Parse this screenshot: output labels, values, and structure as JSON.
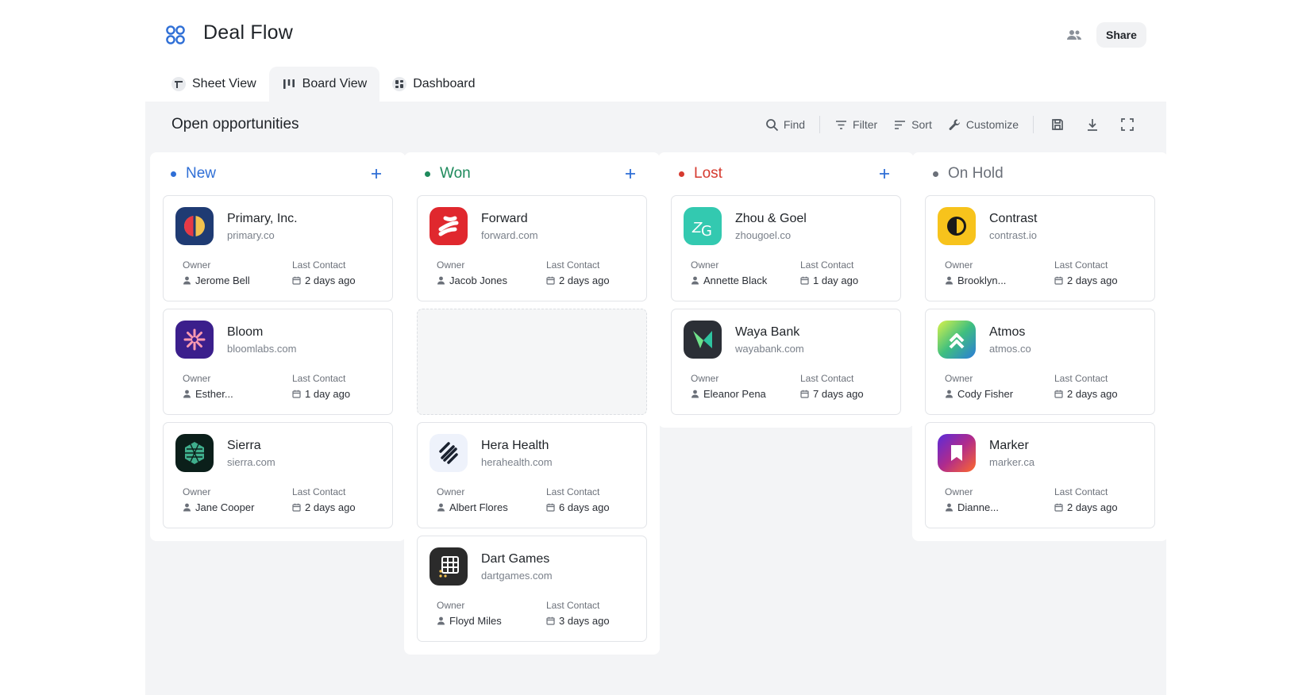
{
  "app": {
    "title": "Deal Flow",
    "share_label": "Share"
  },
  "tabs": [
    {
      "label": "Sheet View",
      "icon": "sheet-icon",
      "active": false
    },
    {
      "label": "Board View",
      "icon": "board-icon",
      "active": true
    },
    {
      "label": "Dashboard",
      "icon": "dashboard-icon",
      "active": false
    }
  ],
  "board": {
    "title": "Open opportunities",
    "toolbar": {
      "find": "Find",
      "filter": "Filter",
      "sort": "Sort",
      "customize": "Customize"
    },
    "field_labels": {
      "owner": "Owner",
      "last_contact": "Last Contact"
    }
  },
  "columns": [
    {
      "title": "New",
      "color": "#2f6fd6",
      "cards": [
        {
          "name": "Primary, Inc.",
          "domain": "primary.co",
          "owner": "Jerome Bell",
          "last_contact": "2 days ago",
          "logo": "primary"
        },
        {
          "name": "Bloom",
          "domain": "bloomlabs.com",
          "owner": "Esther...",
          "last_contact": "1 day ago",
          "logo": "bloom"
        },
        {
          "name": "Sierra",
          "domain": "sierra.com",
          "owner": "Jane Cooper",
          "last_contact": "2 days ago",
          "logo": "sierra"
        }
      ]
    },
    {
      "title": "Won",
      "color": "#1e8a5c",
      "cards": [
        {
          "name": "Forward",
          "domain": "forward.com",
          "owner": "Jacob Jones",
          "last_contact": "2 days ago",
          "logo": "forward"
        },
        {
          "placeholder": true
        },
        {
          "name": "Hera Health",
          "domain": "herahealth.com",
          "owner": "Albert Flores",
          "last_contact": "6 days ago",
          "logo": "hera"
        },
        {
          "name": "Dart Games",
          "domain": "dartgames.com",
          "owner": "Floyd Miles",
          "last_contact": "3 days ago",
          "logo": "dart"
        }
      ]
    },
    {
      "title": "Lost",
      "color": "#d63a2f",
      "cards": [
        {
          "name": "Zhou & Goel",
          "domain": "zhougoel.co",
          "owner": "Annette Black",
          "last_contact": "1 day ago",
          "logo": "zhou"
        },
        {
          "name": "Waya Bank",
          "domain": "wayabank.com",
          "owner": "Eleanor Pena",
          "last_contact": "7 days ago",
          "logo": "waya"
        }
      ]
    },
    {
      "title": "On Hold",
      "color": "#6b7079",
      "cards": [
        {
          "name": "Contrast",
          "domain": "contrast.io",
          "owner": "Brooklyn...",
          "last_contact": "2 days ago",
          "logo": "contrast"
        },
        {
          "name": "Atmos",
          "domain": "atmos.co",
          "owner": "Cody Fisher",
          "last_contact": "2 days ago",
          "logo": "atmos"
        },
        {
          "name": "Marker",
          "domain": "marker.ca",
          "owner": "Dianne...",
          "last_contact": "2 days ago",
          "logo": "marker"
        }
      ]
    }
  ],
  "colors": {
    "accent": "#2f6fd6",
    "panel_bg": "#f3f4f6"
  }
}
